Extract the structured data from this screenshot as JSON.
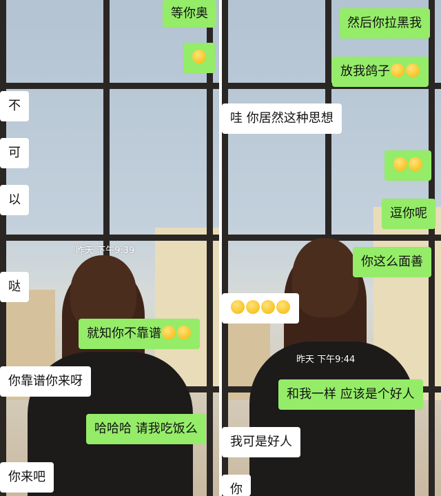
{
  "left_panel": {
    "timestamp": "昨天 下午9:39",
    "messages": [
      {
        "side": "out",
        "text": "等你奥"
      },
      {
        "side": "out",
        "text": "",
        "emoji": [
          "emoji-face"
        ]
      },
      {
        "side": "in",
        "text": "不"
      },
      {
        "side": "in",
        "text": "可"
      },
      {
        "side": "in",
        "text": "以"
      },
      {
        "side": "in",
        "text": "哒"
      },
      {
        "side": "out",
        "text": "就知你不靠谱",
        "emoji": [
          "laugh-cry-emoji",
          "laugh-cry-emoji"
        ]
      },
      {
        "side": "in",
        "text": "你靠谱你来呀"
      },
      {
        "side": "out",
        "text": "哈哈哈 请我吃饭么"
      },
      {
        "side": "in",
        "text": "你来吧"
      }
    ]
  },
  "right_panel": {
    "timestamp": "昨天 下午9:44",
    "messages": [
      {
        "side": "out",
        "text": "然后你拉黑我"
      },
      {
        "side": "out",
        "text": "放我鸽子",
        "emoji": [
          "cry-emoji",
          "face-emoji"
        ]
      },
      {
        "side": "in",
        "text": "哇 你居然这种思想"
      },
      {
        "side": "out",
        "text": "",
        "emoji": [
          "laugh-cry-emoji",
          "laugh-cry-emoji"
        ]
      },
      {
        "side": "out",
        "text": "逗你呢"
      },
      {
        "side": "out",
        "text": "你这么面善"
      },
      {
        "side": "in",
        "text": "",
        "emoji": [
          "face-emoji",
          "face-emoji",
          "face-emoji",
          "face-emoji"
        ]
      },
      {
        "side": "out",
        "text": "和我一样 应该是个好人"
      },
      {
        "side": "in",
        "text": "我可是好人"
      },
      {
        "side": "in",
        "text": "你"
      }
    ]
  }
}
